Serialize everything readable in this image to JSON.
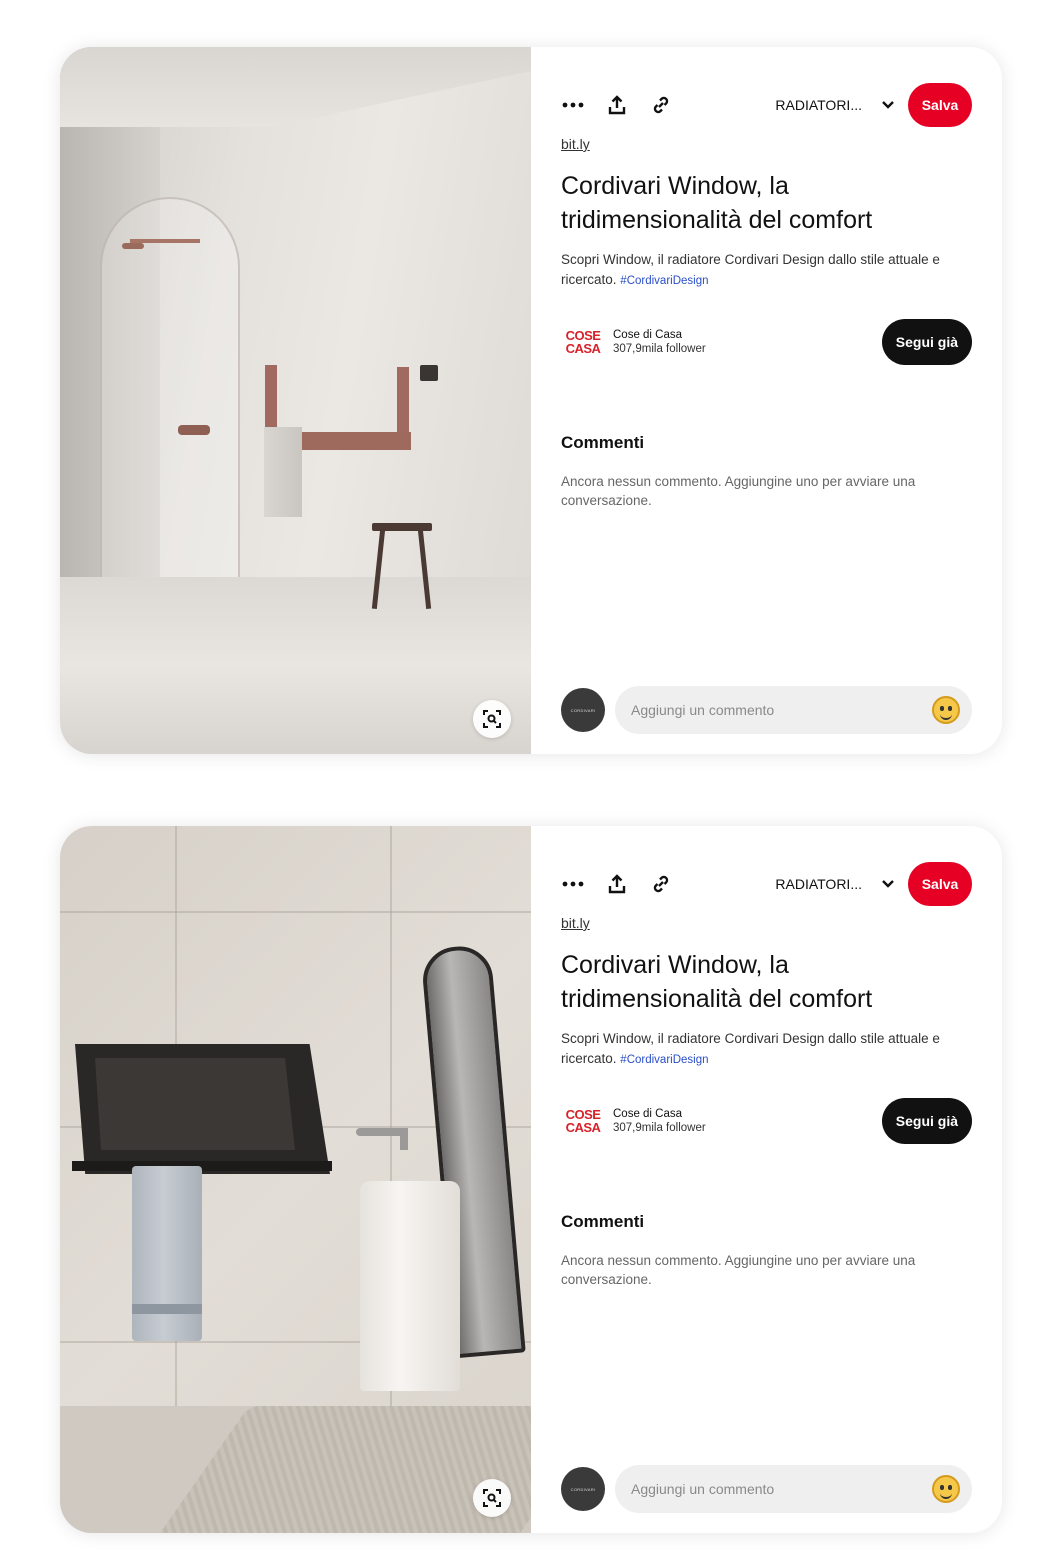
{
  "pins": [
    {
      "board_name": "RADIATORI...",
      "save_label": "Salva",
      "source": "bit.ly",
      "title": "Cordivari Window, la tridimensionalità del comfort",
      "description": "Scopri Window, il radiatore Cordivari Design dallo stile attuale e ricercato.",
      "hashtag": "#CordivariDesign",
      "creator_logo_line1": "COSE",
      "creator_logo_line2": "CASA",
      "creator_name": "Cose di Casa",
      "creator_followers": "307,9mila follower",
      "follow_label": "Segui già",
      "comments_heading": "Commenti",
      "comments_empty": "Ancora nessun commento. Aggiungine uno per avviare una conversazione.",
      "avatar_text": "CORDIVARI",
      "comment_placeholder": "Aggiungi un commento"
    },
    {
      "board_name": "RADIATORI...",
      "save_label": "Salva",
      "source": "bit.ly",
      "title": "Cordivari Window, la tridimensionalità del comfort",
      "description": "Scopri Window, il radiatore Cordivari Design dallo stile attuale e ricercato.",
      "hashtag": "#CordivariDesign",
      "creator_logo_line1": "COSE",
      "creator_logo_line2": "CASA",
      "creator_name": "Cose di Casa",
      "creator_followers": "307,9mila follower",
      "follow_label": "Segui già",
      "comments_heading": "Commenti",
      "comments_empty": "Ancora nessun commento. Aggiungine uno per avviare una conversazione.",
      "avatar_text": "CORDIVARI",
      "comment_placeholder": "Aggiungi un commento"
    }
  ],
  "icons": {
    "more": "more-icon",
    "share": "share-icon",
    "link": "link-icon",
    "chevron": "chevron-down-icon",
    "lens": "visual-search-icon",
    "emoji": "emoji-icon"
  },
  "colors": {
    "save": "#e60023",
    "follow": "#111111",
    "hashtag": "#2a4fc7",
    "creator_logo": "#d8222a"
  }
}
